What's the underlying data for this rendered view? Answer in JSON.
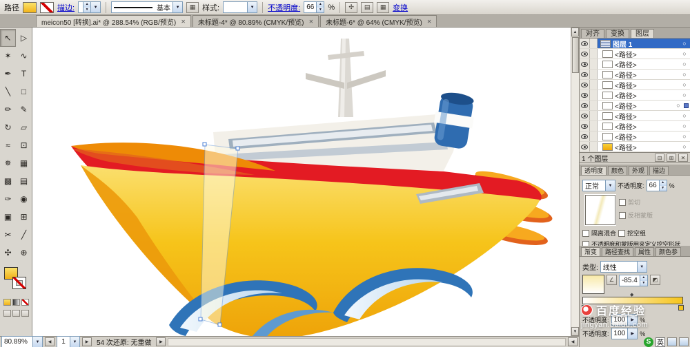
{
  "icons": {
    "dropdown": "▼",
    "up": "▲",
    "down": "▼",
    "left": "◀",
    "right": "▶",
    "close": "✕",
    "target": "○",
    "angle": "∠",
    "reverse": "◩",
    "diamond": "◆",
    "new_sublayer": "⊟",
    "new_layer": "⊞",
    "delete_layer": "✕",
    "grid": "▦",
    "doc": "▤",
    "flow": "✣"
  },
  "colors": {
    "hull_yellow": "#f6c41a",
    "band_red": "#e31b23",
    "bow_orange": "#ee8b06",
    "funnel_blue": "#2f6cb0",
    "wave_blue": "#2f74b8",
    "selection_blue": "#316ac5",
    "link_blue": "#0000cc"
  },
  "options_bar": {
    "title": "路径",
    "stroke_link": "描边:",
    "brush_name": "基本",
    "style_label": "样式:",
    "opacity_link": "不透明度:",
    "opacity_value": "66",
    "opacity_unit": "%",
    "transform_link": "变换"
  },
  "doc_tabs": [
    {
      "label": "meicon50 [转换].ai* @ 288.54% (RGB/预览)"
    },
    {
      "label": "未标题-4* @ 80.89% (CMYK/预览)"
    },
    {
      "label": "未标题-6* @ 64% (CMYK/预览)"
    }
  ],
  "tools": [
    {
      "name": "selection-tool",
      "glyph": "↖"
    },
    {
      "name": "direct-selection-tool",
      "glyph": "▷"
    },
    {
      "name": "magic-wand-tool",
      "glyph": "✶"
    },
    {
      "name": "lasso-tool",
      "glyph": "∿"
    },
    {
      "name": "pen-tool",
      "glyph": "✒"
    },
    {
      "name": "type-tool",
      "glyph": "T"
    },
    {
      "name": "line-tool",
      "glyph": "╲"
    },
    {
      "name": "rectangle-tool",
      "glyph": "□"
    },
    {
      "name": "paintbrush-tool",
      "glyph": "✏"
    },
    {
      "name": "pencil-tool",
      "glyph": "✎"
    },
    {
      "name": "rotate-tool",
      "glyph": "↻"
    },
    {
      "name": "scale-tool",
      "glyph": "▱"
    },
    {
      "name": "warp-tool",
      "glyph": "≈"
    },
    {
      "name": "free-transform-tool",
      "glyph": "⊡"
    },
    {
      "name": "symbol-sprayer-tool",
      "glyph": "✵"
    },
    {
      "name": "graph-tool",
      "glyph": "▦"
    },
    {
      "name": "mesh-tool",
      "glyph": "▩"
    },
    {
      "name": "gradient-tool",
      "glyph": "▤"
    },
    {
      "name": "eyedropper-tool",
      "glyph": "✑"
    },
    {
      "name": "blend-tool",
      "glyph": "◉"
    },
    {
      "name": "live-paint-bucket-tool",
      "glyph": "▣"
    },
    {
      "name": "live-paint-selection-tool",
      "glyph": "⊞"
    },
    {
      "name": "scissors-tool",
      "glyph": "✂"
    },
    {
      "name": "slice-tool",
      "glyph": "╱"
    },
    {
      "name": "hand-tool",
      "glyph": "✣"
    },
    {
      "name": "zoom-tool",
      "glyph": "⊕"
    }
  ],
  "panels": {
    "top_tabs": [
      {
        "label": "对齐"
      },
      {
        "label": "变换"
      },
      {
        "label": "图层"
      }
    ],
    "layers": {
      "active_layer": "图层 1",
      "items": [
        {
          "label": "<路径>"
        },
        {
          "label": "<路径>"
        },
        {
          "label": "<路径>"
        },
        {
          "label": "<路径>"
        },
        {
          "label": "<路径>"
        },
        {
          "label": "<路径>"
        },
        {
          "label": "<路径>"
        },
        {
          "label": "<路径>"
        },
        {
          "label": "<路径>"
        },
        {
          "label": "<路径>"
        }
      ],
      "footer": "1 个图层"
    },
    "transparency": {
      "tabs": [
        {
          "label": "透明度"
        },
        {
          "label": "颜色"
        },
        {
          "label": "外观"
        },
        {
          "label": "描边"
        }
      ],
      "blend_mode": "正常",
      "opacity_label": "不透明度:",
      "opacity_value": "66",
      "opacity_unit": "%",
      "clip_label": "剪切",
      "invert_mask_label": "反相蒙版",
      "isolate_label": "隔离混合",
      "knockout_label": "挖空组",
      "knockout_define_label": "不透明度和蒙版用来定义挖空形状"
    },
    "gradient": {
      "tabs": [
        {
          "label": "渐变"
        },
        {
          "label": "路径查找"
        },
        {
          "label": "属性"
        },
        {
          "label": "颜色参"
        }
      ],
      "type_label": "类型:",
      "type_value": "线性",
      "angle_value": "-85.4",
      "stop_opacity_label": "不透明度:",
      "stop_opacity_value": "100",
      "stop_opacity_unit": "%",
      "stop2_opacity_label": "不透明度:",
      "stop2_opacity_value": "100",
      "stop2_opacity_unit": "%"
    }
  },
  "status_bar": {
    "zoom": "80.89%",
    "page": "1",
    "message": "54 次还原: 无重做"
  },
  "watermark": {
    "title": "百度经验",
    "url": "jingyan.baidu.com"
  },
  "taskbar": {
    "sogou": "S",
    "ime": "英"
  }
}
